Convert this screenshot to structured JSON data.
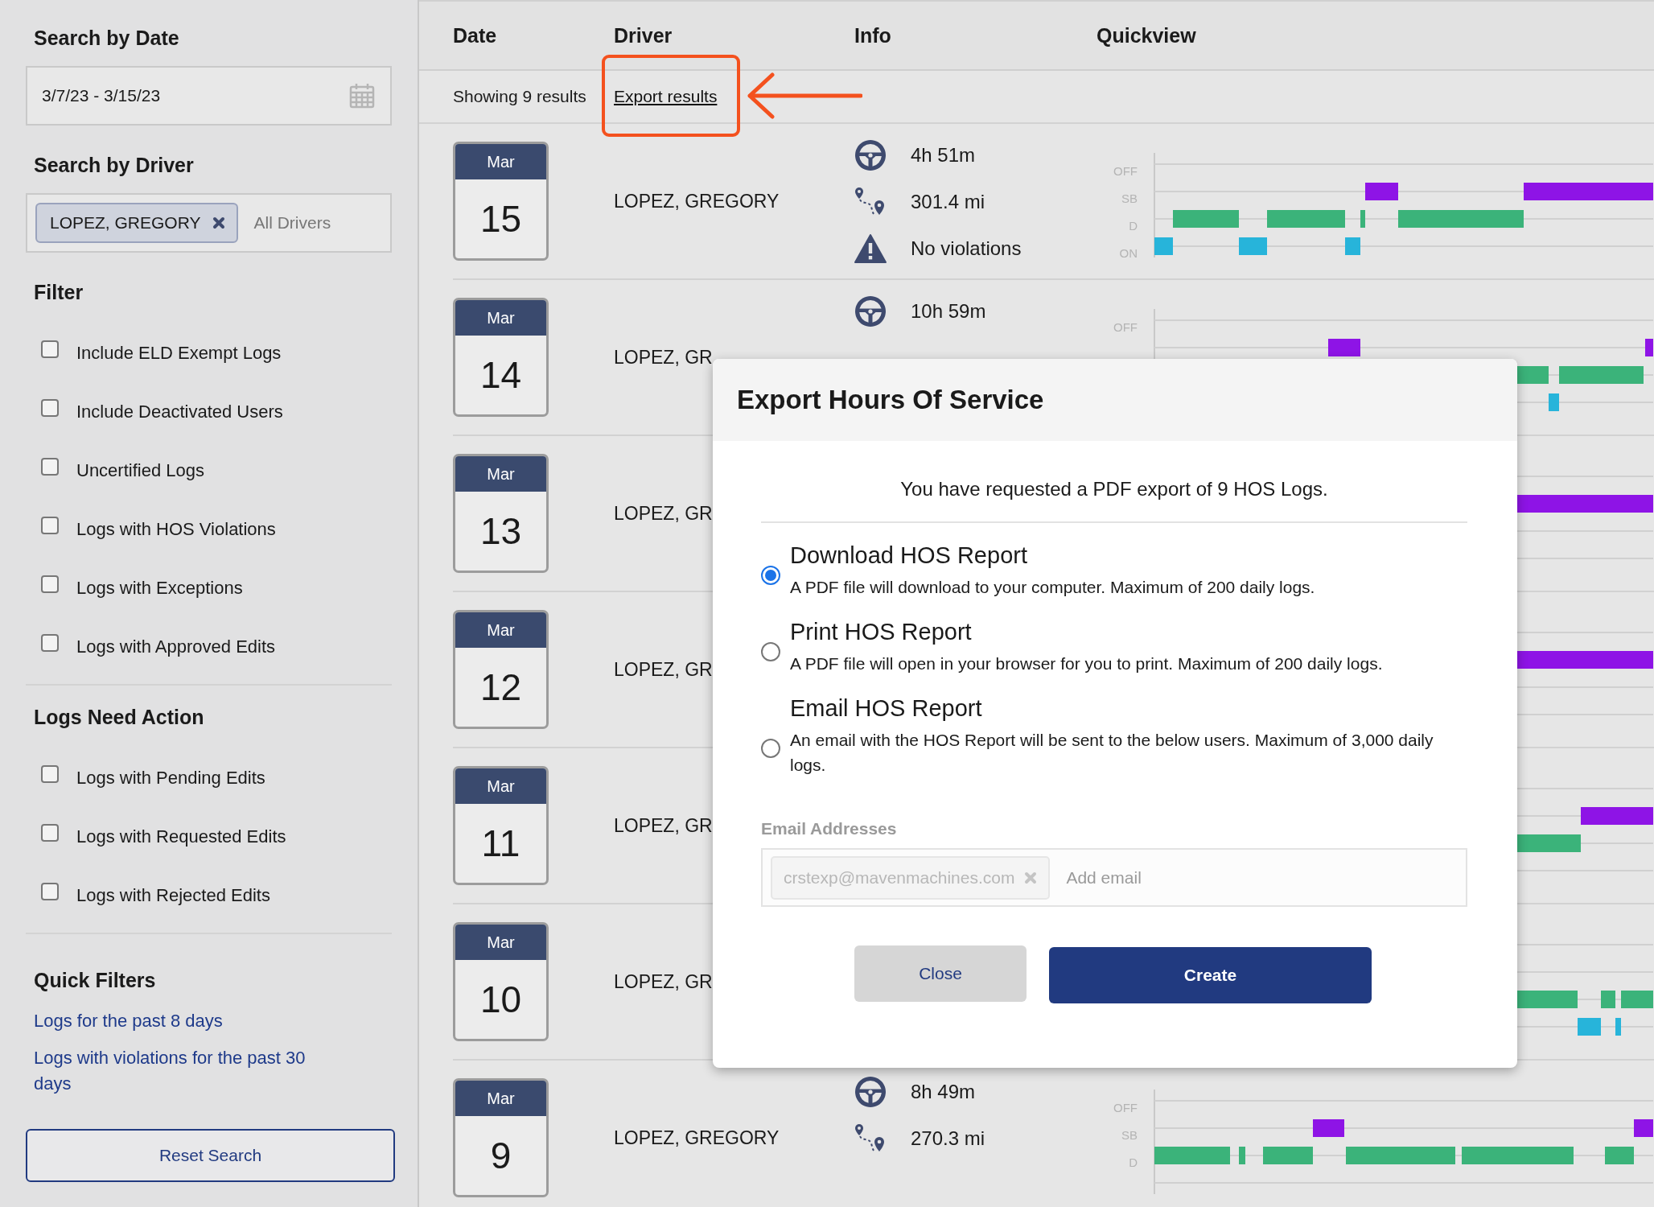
{
  "sidebar": {
    "date_search": {
      "heading": "Search by Date",
      "value": "3/7/23 - 3/15/23"
    },
    "driver_search": {
      "heading": "Search by Driver",
      "chip": "LOPEZ, GREGORY",
      "placeholder": "All Drivers"
    },
    "filter": {
      "heading": "Filter",
      "options": [
        {
          "label": "Include ELD Exempt Logs",
          "checked": false
        },
        {
          "label": "Include Deactivated Users",
          "checked": false
        },
        {
          "label": "Uncertified Logs",
          "checked": false
        },
        {
          "label": "Logs with HOS Violations",
          "checked": false
        },
        {
          "label": "Logs with Exceptions",
          "checked": false
        },
        {
          "label": "Logs with Approved Edits",
          "checked": false
        }
      ]
    },
    "logs_need_action": {
      "heading": "Logs Need Action",
      "options": [
        {
          "label": "Logs with Pending Edits",
          "checked": false
        },
        {
          "label": "Logs with Requested Edits",
          "checked": false
        },
        {
          "label": "Logs with Rejected Edits",
          "checked": false
        }
      ]
    },
    "quick_filters": {
      "heading": "Quick Filters",
      "links": [
        "Logs for the past 8 days",
        "Logs with violations for the past 30 days"
      ]
    },
    "reset_button": "Reset Search"
  },
  "table": {
    "columns": [
      "Date",
      "Driver",
      "Info",
      "Quickview"
    ],
    "result_count": "Showing 9 results",
    "export_link": "Export results",
    "rows": [
      {
        "month": "Mar",
        "day": "15",
        "driver": "LOPEZ, GREGORY",
        "drive_time": "4h 51m",
        "distance": "301.4 mi",
        "violations": "No violations",
        "status_labels": [
          "OFF",
          "SB",
          "D",
          "ON"
        ]
      },
      {
        "month": "Mar",
        "day": "14",
        "driver": "LOPEZ, GR",
        "drive_time": "10h 59m",
        "status_labels": [
          "OFF"
        ]
      },
      {
        "month": "Mar",
        "day": "13",
        "driver": "LOPEZ, GR"
      },
      {
        "month": "Mar",
        "day": "12",
        "driver": "LOPEZ, GR"
      },
      {
        "month": "Mar",
        "day": "11",
        "driver": "LOPEZ, GR"
      },
      {
        "month": "Mar",
        "day": "10",
        "driver": "LOPEZ, GR"
      },
      {
        "month": "Mar",
        "day": "9",
        "driver": "LOPEZ, GREGORY",
        "drive_time": "8h 49m",
        "distance": "270.3 mi",
        "status_labels": [
          "OFF",
          "SB",
          "D"
        ]
      }
    ]
  },
  "modal": {
    "title": "Export Hours Of Service",
    "summary": "You have requested a PDF export of 9 HOS Logs.",
    "options": [
      {
        "title": "Download HOS Report",
        "description": "A PDF file will download to your computer. Maximum of 200 daily logs.",
        "selected": true
      },
      {
        "title": "Print HOS Report",
        "description": "A PDF file will open in your browser for you to print. Maximum of 200 daily logs.",
        "selected": false
      },
      {
        "title": "Email HOS Report",
        "description": "An email with the HOS Report will be sent to the below users. Maximum of 3,000 daily logs.",
        "selected": false
      }
    ],
    "email_label": "Email Addresses",
    "email_chip": "crstexp@mavenmachines.com",
    "email_placeholder": "Add email",
    "buttons": [
      {
        "label": "Close",
        "kind": "secondary"
      },
      {
        "label": "Create",
        "kind": "primary"
      }
    ]
  }
}
